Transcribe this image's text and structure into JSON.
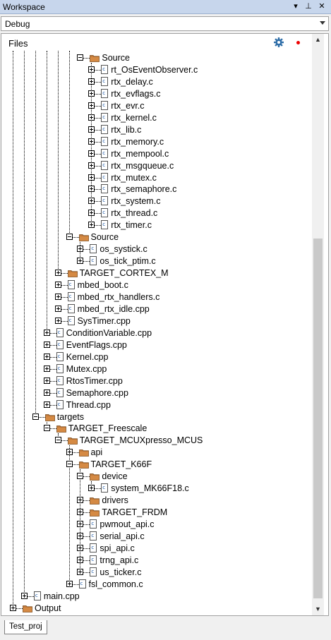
{
  "window": {
    "title": "Workspace",
    "title_buttons": [
      {
        "name": "dropdown-arrow-icon",
        "glyph": "▾"
      },
      {
        "name": "pin-icon",
        "glyph": "⊥"
      },
      {
        "name": "close-icon",
        "glyph": "✕"
      }
    ]
  },
  "config": {
    "selected": "Debug"
  },
  "panel": {
    "header_label": "Files",
    "settings_icon": "gear-icon",
    "status_icon": "red-dot-icon"
  },
  "tree": [
    {
      "depth": 6,
      "type": "folder",
      "label": "Source",
      "expanded": true
    },
    {
      "depth": 7,
      "type": "file",
      "label": "rt_OsEventObserver.c"
    },
    {
      "depth": 7,
      "type": "file",
      "label": "rtx_delay.c"
    },
    {
      "depth": 7,
      "type": "file",
      "label": "rtx_evflags.c"
    },
    {
      "depth": 7,
      "type": "file",
      "label": "rtx_evr.c"
    },
    {
      "depth": 7,
      "type": "file",
      "label": "rtx_kernel.c"
    },
    {
      "depth": 7,
      "type": "file",
      "label": "rtx_lib.c"
    },
    {
      "depth": 7,
      "type": "file",
      "label": "rtx_memory.c"
    },
    {
      "depth": 7,
      "type": "file",
      "label": "rtx_mempool.c"
    },
    {
      "depth": 7,
      "type": "file",
      "label": "rtx_msgqueue.c"
    },
    {
      "depth": 7,
      "type": "file",
      "label": "rtx_mutex.c"
    },
    {
      "depth": 7,
      "type": "file",
      "label": "rtx_semaphore.c"
    },
    {
      "depth": 7,
      "type": "file",
      "label": "rtx_system.c"
    },
    {
      "depth": 7,
      "type": "file",
      "label": "rtx_thread.c"
    },
    {
      "depth": 7,
      "type": "file",
      "label": "rtx_timer.c"
    },
    {
      "depth": 5,
      "type": "folder",
      "label": "Source",
      "expanded": true
    },
    {
      "depth": 6,
      "type": "file",
      "label": "os_systick.c"
    },
    {
      "depth": 6,
      "type": "file",
      "label": "os_tick_ptim.c"
    },
    {
      "depth": 4,
      "type": "folder",
      "label": "TARGET_CORTEX_M",
      "expanded": false
    },
    {
      "depth": 4,
      "type": "file",
      "label": "mbed_boot.c"
    },
    {
      "depth": 4,
      "type": "file",
      "label": "mbed_rtx_handlers.c"
    },
    {
      "depth": 4,
      "type": "file",
      "label": "mbed_rtx_idle.cpp"
    },
    {
      "depth": 4,
      "type": "file",
      "label": "SysTimer.cpp"
    },
    {
      "depth": 3,
      "type": "file",
      "label": "ConditionVariable.cpp"
    },
    {
      "depth": 3,
      "type": "file",
      "label": "EventFlags.cpp"
    },
    {
      "depth": 3,
      "type": "file",
      "label": "Kernel.cpp"
    },
    {
      "depth": 3,
      "type": "file",
      "label": "Mutex.cpp"
    },
    {
      "depth": 3,
      "type": "file",
      "label": "RtosTimer.cpp"
    },
    {
      "depth": 3,
      "type": "file",
      "label": "Semaphore.cpp"
    },
    {
      "depth": 3,
      "type": "file",
      "label": "Thread.cpp"
    },
    {
      "depth": 2,
      "type": "folder",
      "label": "targets",
      "expanded": true
    },
    {
      "depth": 3,
      "type": "folder",
      "label": "TARGET_Freescale",
      "expanded": true
    },
    {
      "depth": 4,
      "type": "folder",
      "label": "TARGET_MCUXpresso_MCUS",
      "expanded": true
    },
    {
      "depth": 5,
      "type": "folder",
      "label": "api",
      "expanded": false
    },
    {
      "depth": 5,
      "type": "folder",
      "label": "TARGET_K66F",
      "expanded": true
    },
    {
      "depth": 6,
      "type": "folder",
      "label": "device",
      "expanded": true
    },
    {
      "depth": 7,
      "type": "file",
      "label": "system_MK66F18.c"
    },
    {
      "depth": 6,
      "type": "folder",
      "label": "drivers",
      "expanded": false
    },
    {
      "depth": 6,
      "type": "folder",
      "label": "TARGET_FRDM",
      "expanded": false
    },
    {
      "depth": 6,
      "type": "file",
      "label": "pwmout_api.c"
    },
    {
      "depth": 6,
      "type": "file",
      "label": "serial_api.c"
    },
    {
      "depth": 6,
      "type": "file",
      "label": "spi_api.c"
    },
    {
      "depth": 6,
      "type": "file",
      "label": "trng_api.c"
    },
    {
      "depth": 6,
      "type": "file",
      "label": "us_ticker.c"
    },
    {
      "depth": 5,
      "type": "file",
      "label": "fsl_common.c"
    },
    {
      "depth": 1,
      "type": "file",
      "label": "main.cpp"
    },
    {
      "depth": 0,
      "type": "folder",
      "label": "Output",
      "expanded": false
    }
  ],
  "scrollbar": {
    "position": 0.82
  },
  "bottom_tabs": [
    {
      "label": "Test_proj",
      "active": true
    }
  ],
  "colors": {
    "titlebar": "#c7d6ec",
    "folder": "#c27a3a",
    "gear": "#2f6ea8",
    "dot": "#e00000"
  }
}
